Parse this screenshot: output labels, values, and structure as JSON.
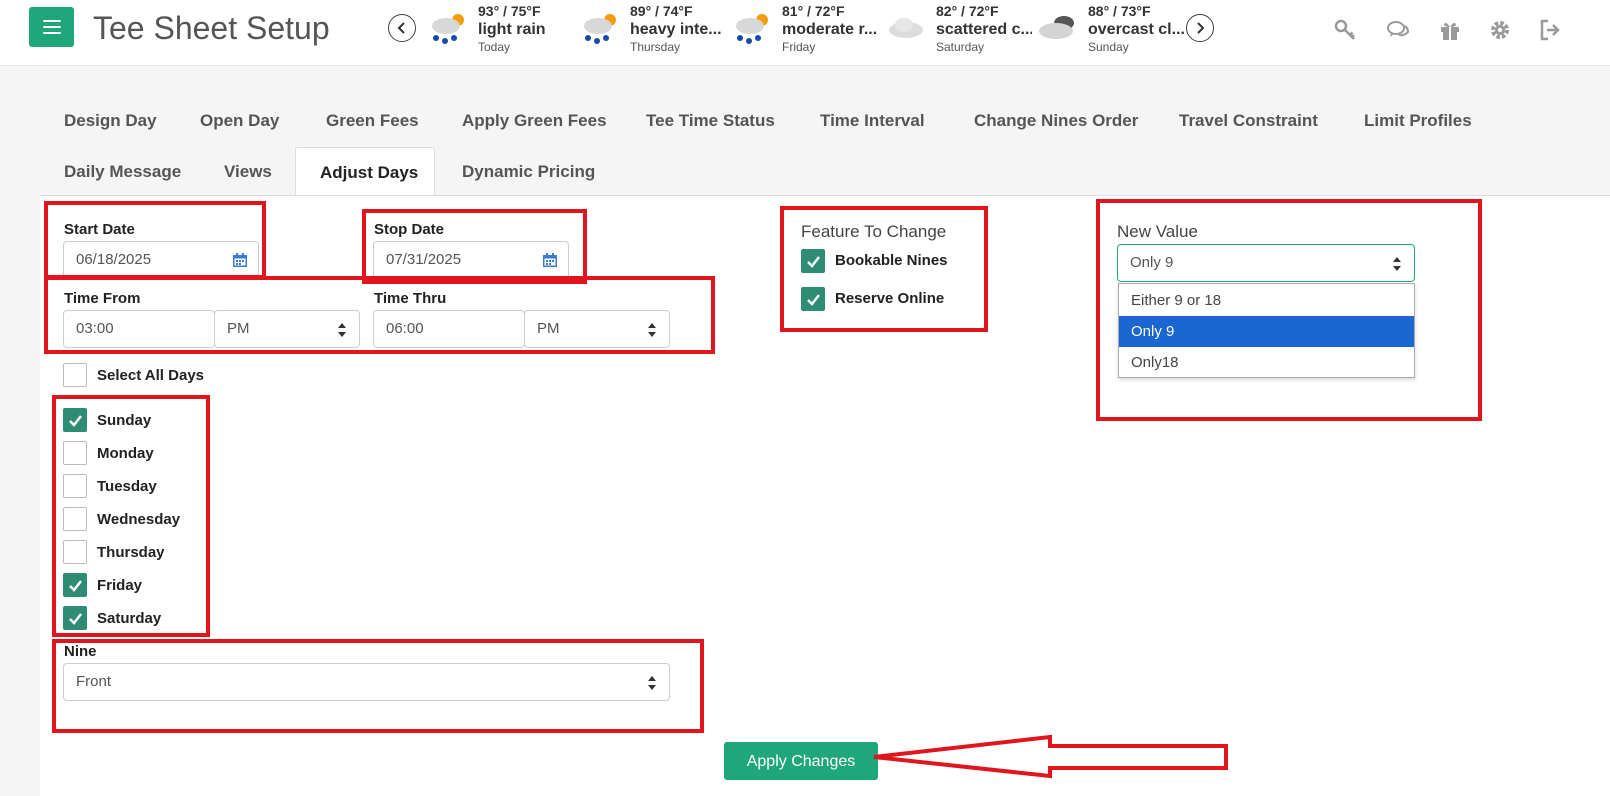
{
  "header": {
    "title": "Tee Sheet Setup",
    "weather": [
      {
        "temp": "93° / 75°F",
        "condition": "light rain",
        "day": "Today",
        "icon": "rain-sun-icon"
      },
      {
        "temp": "89° / 74°F",
        "condition": "heavy inte...",
        "day": "Thursday",
        "icon": "rain-sun-icon"
      },
      {
        "temp": "81° / 72°F",
        "condition": "moderate r...",
        "day": "Friday",
        "icon": "rain-sun-icon"
      },
      {
        "temp": "82° / 72°F",
        "condition": "scattered c...",
        "day": "Saturday",
        "icon": "cloud-icon"
      },
      {
        "temp": "88° / 73°F",
        "condition": "overcast cl...",
        "day": "Sunday",
        "icon": "overcast-icon"
      }
    ],
    "icons": [
      "key-icon",
      "chat-icon",
      "gift-icon",
      "gear-icon",
      "logout-icon"
    ]
  },
  "tabs": {
    "row1": [
      "Design Day",
      "Open Day",
      "Green Fees",
      "Apply Green Fees",
      "Tee Time Status",
      "Time Interval",
      "Change Nines Order",
      "Travel Constraint",
      "Limit Profiles"
    ],
    "row2": [
      "Daily Message",
      "Views",
      "Adjust Days",
      "Dynamic Pricing"
    ],
    "active": "Adjust Days"
  },
  "form": {
    "start_date_label": "Start Date",
    "start_date": "06/18/2025",
    "stop_date_label": "Stop Date",
    "stop_date": "07/31/2025",
    "time_from_label": "Time From",
    "time_from": "03:00",
    "time_from_ampm": "PM",
    "time_thru_label": "Time Thru",
    "time_thru": "06:00",
    "time_thru_ampm": "PM",
    "select_all_label": "Select All Days",
    "days": [
      {
        "label": "Sunday",
        "checked": true
      },
      {
        "label": "Monday",
        "checked": false
      },
      {
        "label": "Tuesday",
        "checked": false
      },
      {
        "label": "Wednesday",
        "checked": false
      },
      {
        "label": "Thursday",
        "checked": false
      },
      {
        "label": "Friday",
        "checked": true
      },
      {
        "label": "Saturday",
        "checked": true
      }
    ],
    "nine_label": "Nine",
    "nine_value": "Front",
    "feature_label": "Feature To Change",
    "features": [
      {
        "label": "Bookable Nines",
        "checked": true
      },
      {
        "label": "Reserve Online",
        "checked": true
      }
    ],
    "new_value_label": "New Value",
    "new_value": "Only 9",
    "new_value_options": [
      "Either 9 or 18",
      "Only 9",
      "Only18"
    ],
    "new_value_selected_index": 1,
    "apply_label": "Apply Changes"
  },
  "colors": {
    "accent": "#1fa67a",
    "checkbox_on": "#2e8b74",
    "highlight_red": "#e0151e",
    "option_selected": "#1b66d1"
  }
}
